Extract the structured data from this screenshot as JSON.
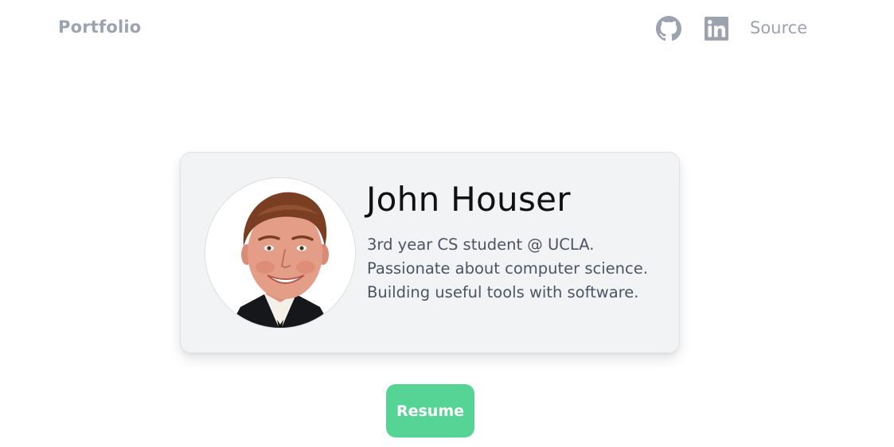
{
  "nav": {
    "brand": "Portfolio",
    "source_label": "Source",
    "icons": [
      "github-icon",
      "linkedin-icon"
    ]
  },
  "profile": {
    "name": "John Houser",
    "bio": [
      "3rd year CS student @ UCLA.",
      "Passionate about computer science.",
      "Building useful tools with software."
    ]
  },
  "actions": {
    "resume_label": "Resume"
  },
  "colors": {
    "nav_text": "#9ca3af",
    "card_bg": "#f2f3f5",
    "accent_button": "#55d496",
    "bio_text": "#4b5563"
  }
}
